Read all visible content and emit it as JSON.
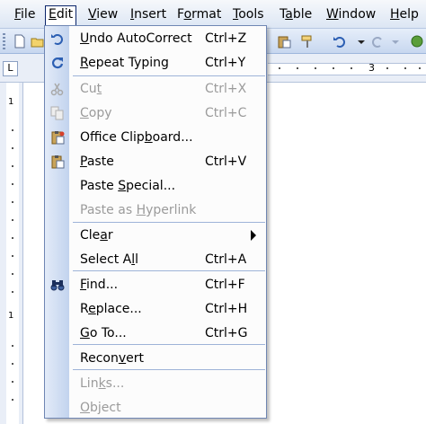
{
  "menubar": {
    "items": [
      {
        "label": "File",
        "u": "F"
      },
      {
        "label": "Edit",
        "u": "E"
      },
      {
        "label": "View",
        "u": "V"
      },
      {
        "label": "Insert",
        "u": "I"
      },
      {
        "label": "Format",
        "u": "o"
      },
      {
        "label": "Tools",
        "u": "T"
      },
      {
        "label": "Table",
        "u": "a"
      },
      {
        "label": "Window",
        "u": "W"
      },
      {
        "label": "Help",
        "u": "H"
      }
    ]
  },
  "ruler": {
    "tab_selector": "L",
    "h_number": "3",
    "v_numbers": [
      "1",
      "1"
    ]
  },
  "toolbar": {
    "icons": [
      "new-document-icon",
      "open-icon",
      "paste-icon",
      "format-painter-icon",
      "undo-icon",
      "redo-icon",
      "hyperlink-icon"
    ]
  },
  "edit_menu": {
    "items": [
      {
        "key": "undo",
        "label": "Undo AutoCorrect",
        "u": "U",
        "shortcut": "Ctrl+Z",
        "enabled": true,
        "icon": "undo-icon"
      },
      {
        "key": "repeat",
        "label": "Repeat Typing",
        "u": "R",
        "shortcut": "Ctrl+Y",
        "enabled": true,
        "icon": "repeat-icon"
      },
      {
        "key": "cut",
        "label": "Cut",
        "u": "t",
        "shortcut": "Ctrl+X",
        "enabled": false,
        "icon": "scissors-icon"
      },
      {
        "key": "copy",
        "label": "Copy",
        "u": "C",
        "shortcut": "Ctrl+C",
        "enabled": false,
        "icon": "copy-icon"
      },
      {
        "key": "clipboard",
        "label": "Office Clipboard...",
        "u": "b",
        "shortcut": "",
        "enabled": true,
        "icon": "clipboard-icon"
      },
      {
        "key": "paste",
        "label": "Paste",
        "u": "P",
        "shortcut": "Ctrl+V",
        "enabled": true,
        "icon": "paste-icon"
      },
      {
        "key": "paste-special",
        "label": "Paste Special...",
        "u": "S",
        "shortcut": "",
        "enabled": true,
        "icon": ""
      },
      {
        "key": "paste-hyperlink",
        "label": "Paste as Hyperlink",
        "u": "H",
        "shortcut": "",
        "enabled": false,
        "icon": ""
      },
      {
        "key": "clear",
        "label": "Clear",
        "u": "a",
        "shortcut": "",
        "enabled": true,
        "icon": "",
        "submenu": true
      },
      {
        "key": "select-all",
        "label": "Select All",
        "u": "l",
        "shortcut": "Ctrl+A",
        "enabled": true,
        "icon": ""
      },
      {
        "key": "find",
        "label": "Find...",
        "u": "F",
        "shortcut": "Ctrl+F",
        "enabled": true,
        "icon": "binoculars-icon"
      },
      {
        "key": "replace",
        "label": "Replace...",
        "u": "e",
        "shortcut": "Ctrl+H",
        "enabled": true,
        "icon": ""
      },
      {
        "key": "goto",
        "label": "Go To...",
        "u": "G",
        "shortcut": "Ctrl+G",
        "enabled": true,
        "icon": ""
      },
      {
        "key": "reconvert",
        "label": "Reconvert",
        "u": "v",
        "shortcut": "",
        "enabled": true,
        "icon": ""
      },
      {
        "key": "links",
        "label": "Links...",
        "u": "k",
        "shortcut": "",
        "enabled": false,
        "icon": ""
      },
      {
        "key": "object",
        "label": "Object",
        "u": "O",
        "shortcut": "",
        "enabled": false,
        "icon": ""
      }
    ]
  },
  "colors": {
    "menu_border": "#6f86b3",
    "gutter": "#c2d3ee",
    "disabled_text": "#9b9b9b"
  }
}
